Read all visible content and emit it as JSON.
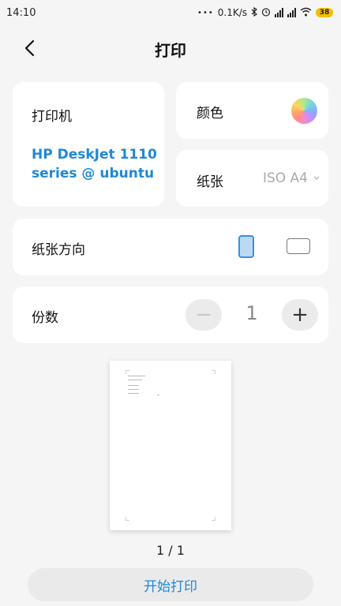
{
  "status_bar": {
    "time": "14:10",
    "network_speed": "0.1K/s",
    "battery": "38"
  },
  "header": {
    "title": "打印"
  },
  "printer": {
    "label": "打印机",
    "name": "HP DeskJet 1110 series @ ubuntu"
  },
  "color": {
    "label": "颜色"
  },
  "paper": {
    "label": "纸张",
    "value": "ISO A4"
  },
  "orientation": {
    "label": "纸张方向",
    "selected": "portrait"
  },
  "copies": {
    "label": "份数",
    "minus": "−",
    "value": "1",
    "plus": "+"
  },
  "preview": {
    "page_indicator": "1 / 1"
  },
  "actions": {
    "start_print": "开始打印"
  },
  "colors": {
    "accent": "#1e88d6",
    "background": "#f5f5f5",
    "card": "#ffffff"
  }
}
